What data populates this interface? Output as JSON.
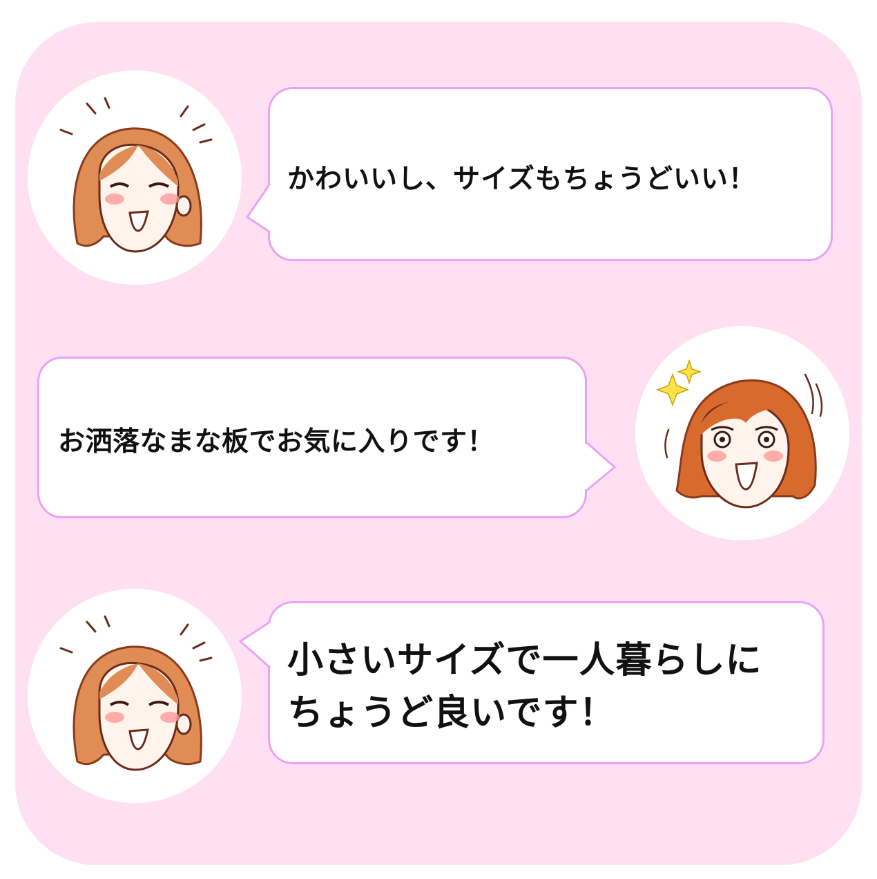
{
  "theme": {
    "background": "#ffffff",
    "panel": "#ffe0f3",
    "bubble_border": "#e9a3f3",
    "hair": "#e08c55",
    "hair_dark": "#c0602e",
    "blush": "#ff9a9a"
  },
  "messages": [
    {
      "speaker": "woman-smiling-avatar",
      "text": "かわいいし、サイズもちょうどいい！"
    },
    {
      "speaker": "woman-sparkling-avatar",
      "text": "お洒落なまな板でお気に入りです！"
    },
    {
      "speaker": "woman-smiling-avatar",
      "lines": [
        "小さいサイズで一人暮らしに",
        "ちょうど良いです！"
      ]
    }
  ]
}
